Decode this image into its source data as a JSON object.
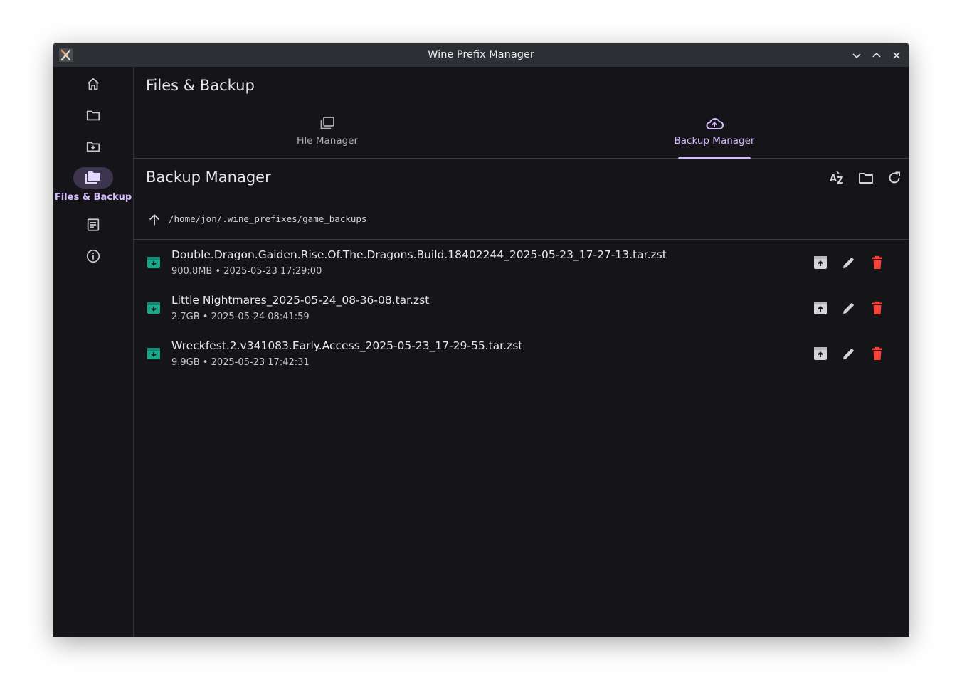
{
  "window": {
    "title": "Wine Prefix Manager"
  },
  "sidebar": {
    "items": [
      {
        "icon": "home-icon"
      },
      {
        "icon": "folder-icon"
      },
      {
        "icon": "folder-add-icon"
      },
      {
        "icon": "folders-icon",
        "label": "Files & Backup",
        "active": true
      },
      {
        "icon": "document-list-icon"
      },
      {
        "icon": "info-icon"
      }
    ]
  },
  "main": {
    "title": "Files & Backup",
    "tabs": [
      {
        "label": "File Manager",
        "icon": "copy-icon"
      },
      {
        "label": "Backup Manager",
        "icon": "cloud-upload-icon",
        "active": true
      }
    ],
    "section_title": "Backup Manager",
    "path": "/home/jon/.wine_prefixes/game_backups",
    "backups": [
      {
        "name": "Double.Dragon.Gaiden.Rise.Of.The.Dragons.Build.18402244_2025-05-23_17-27-13.tar.zst",
        "meta": "900.8MB • 2025-05-23 17:29:00"
      },
      {
        "name": "Little Nightmares_2025-05-24_08-36-08.tar.zst",
        "meta": "2.7GB • 2025-05-24 08:41:59"
      },
      {
        "name": "Wreckfest.2.v341083.Early.Access_2025-05-23_17-29-55.tar.zst",
        "meta": "9.9GB • 2025-05-23 17:42:31"
      }
    ]
  },
  "colors": {
    "accent": "#d2bcfd",
    "archive": "#18a88a",
    "delete": "#f44336",
    "background": "#151419"
  }
}
